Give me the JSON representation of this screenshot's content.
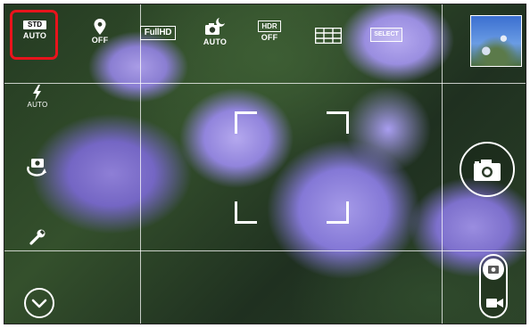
{
  "toolbar": {
    "scene_top": "STD",
    "scene_bottom": "AUTO",
    "location_label": "OFF",
    "resolution_label": "FullHD",
    "night_label": "AUTO",
    "hdr_top": "HDR",
    "hdr_label": "OFF",
    "select_label": "SELECT"
  },
  "side": {
    "flash_label": "AUTO"
  },
  "colors": {
    "highlight": "#e8141c",
    "icon": "#ffffff"
  },
  "icons": [
    "scene-std-auto-icon",
    "location-pin-icon",
    "resolution-fullhd-icon",
    "night-mode-icon",
    "hdr-icon",
    "grid-icon",
    "select-icon",
    "gallery-thumbnail",
    "flash-auto-icon",
    "camera-switch-icon",
    "settings-wrench-icon",
    "menu-chevron-icon",
    "shutter-camera-icon",
    "video-camera-icon"
  ]
}
